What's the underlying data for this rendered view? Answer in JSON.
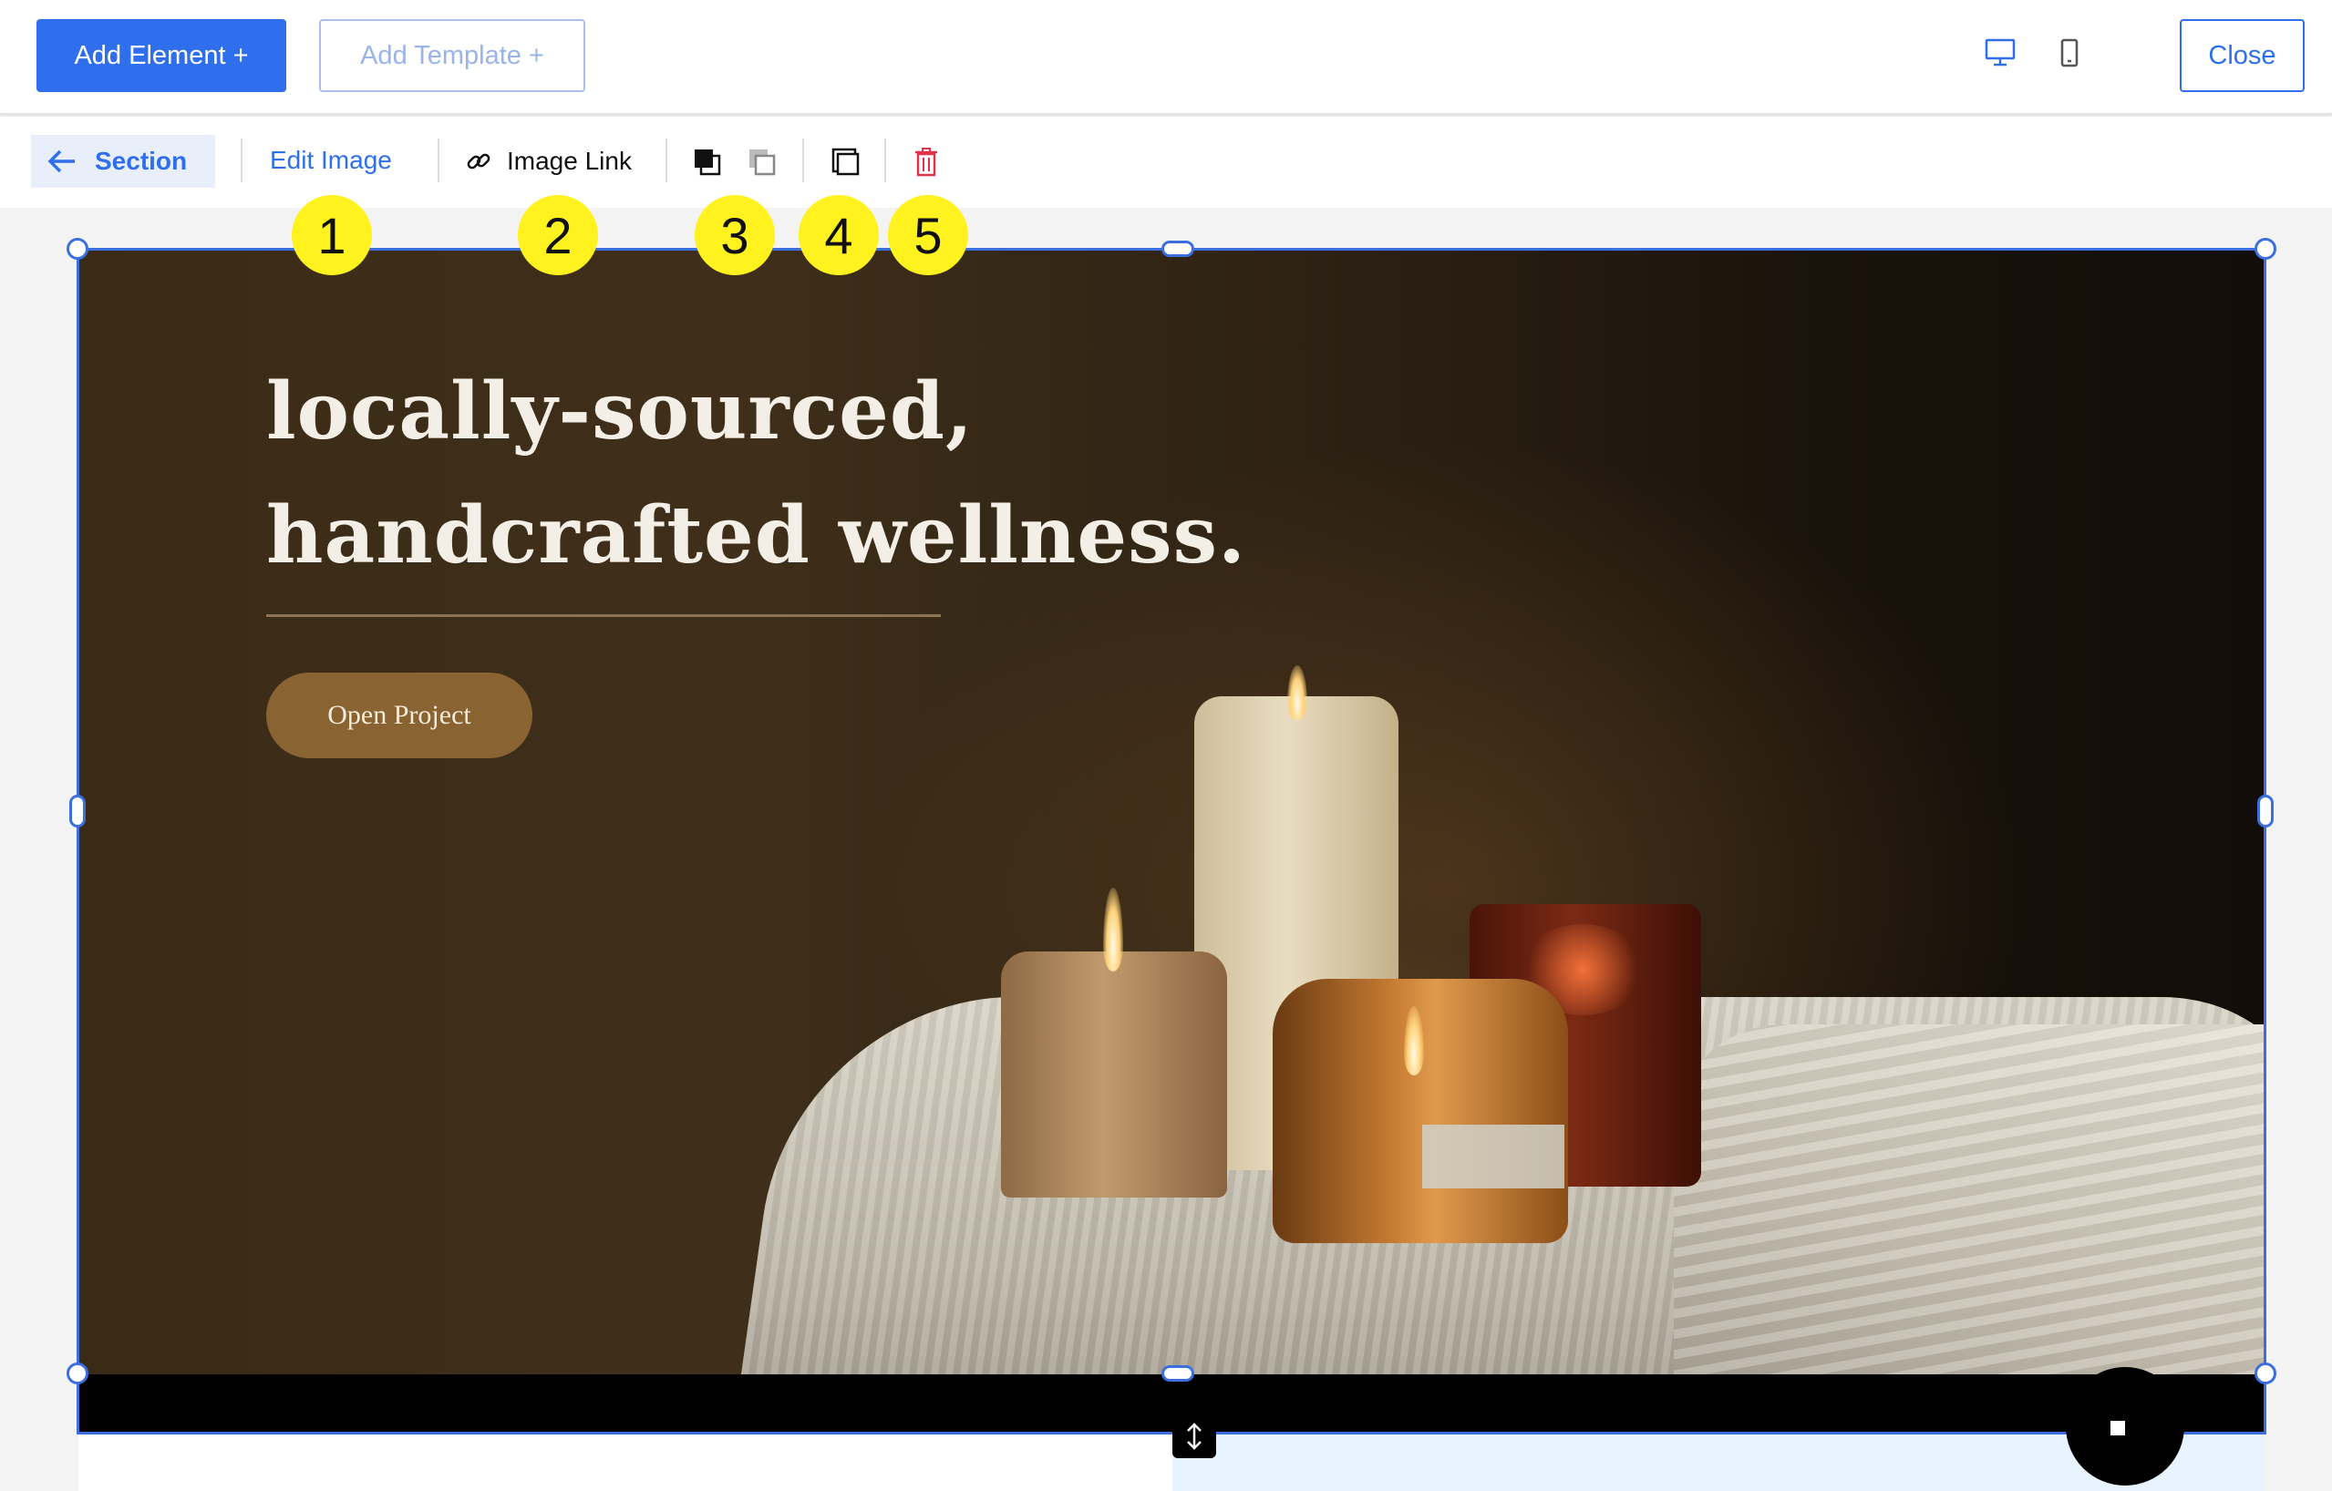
{
  "topbar": {
    "add_element_label": "Add Element +",
    "add_template_label": "Add Template +",
    "close_label": "Close",
    "icons": [
      "desktop-icon",
      "mobile-icon"
    ]
  },
  "toolbar": {
    "section_label": "Section",
    "edit_image_label": "Edit Image",
    "image_link_label": "Image Link",
    "icons": [
      "back-arrow-icon",
      "link-icon",
      "bring-forward-icon",
      "send-backward-icon",
      "duplicate-icon",
      "trash-icon"
    ]
  },
  "hero": {
    "title_line1": "locally-sourced,",
    "title_line2": "handcrafted wellness.",
    "button_label": "Open Project"
  },
  "markers": [
    "1",
    "2",
    "3",
    "4",
    "5"
  ],
  "colors": {
    "accent": "#2f6fed",
    "selection": "#3b6fe0",
    "marker": "#fff21e",
    "danger": "#e0334c",
    "hero_button": "#8a6332"
  }
}
